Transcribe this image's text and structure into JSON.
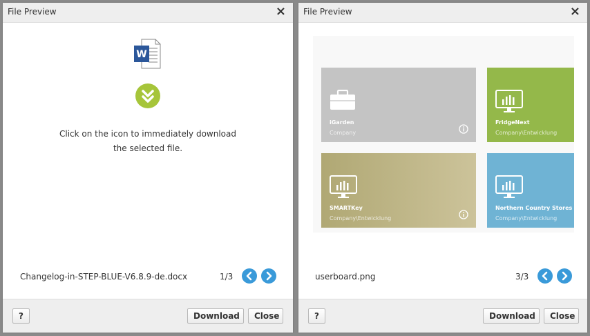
{
  "dialogs": [
    {
      "title": "File Preview",
      "close_icon": "×",
      "message_line1": "Click on the icon to immediately download",
      "message_line2": "the selected file.",
      "file_name": "Changelog-in-STEP-BLUE-V6.8.9-de.docx",
      "pager": "1/3",
      "help_label": "?",
      "download_label": "Download",
      "close_label": "Close",
      "word_icon_letter": "W"
    },
    {
      "title": "File Preview",
      "close_icon": "×",
      "file_name": "userboard.png",
      "pager": "3/3",
      "help_label": "?",
      "download_label": "Download",
      "close_label": "Close",
      "tiles": [
        {
          "name": "iGarden",
          "sub": "Company",
          "icon": "briefcase-icon"
        },
        {
          "name": "FridgeNext",
          "sub": "Company\\Entwicklung",
          "icon": "monitor-chart-icon"
        },
        {
          "name": "SMARTKey",
          "sub": "Company\\Entwicklung",
          "icon": "monitor-chart-icon"
        },
        {
          "name": "Northern Country Stores",
          "sub": "Company\\Entwicklung",
          "icon": "monitor-chart-icon"
        }
      ]
    }
  ],
  "colors": {
    "accent_blue": "#3a9ad9",
    "download_green": "#a6c53a",
    "word_blue": "#2b579a"
  }
}
